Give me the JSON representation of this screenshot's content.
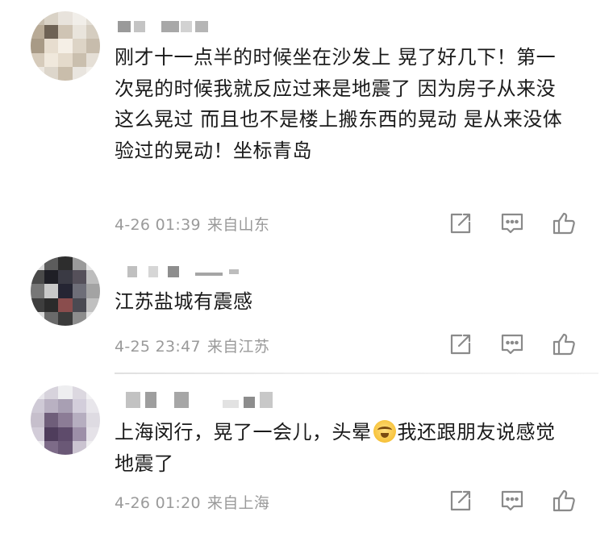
{
  "comments": [
    {
      "content": "刚才十一点半的时候坐在沙发上 晃了好几下！第一次晃的时候我就反应过来是地震了 因为房子从来没这么晃过 而且也不是楼上搬东西的晃动 是从来没体验过的晃动！坐标青岛",
      "time": "4-26 01:39",
      "location": "来自山东"
    },
    {
      "content": "江苏盐城有震感",
      "time": "4-25 23:47",
      "location": "来自江苏"
    },
    {
      "content_before_emoji": "上海闵行，晃了一会儿，头晕",
      "emoji": "crying-laughing-emoji",
      "content_after_emoji": "我还跟朋友说感觉地震了",
      "time": "4-26 01:20",
      "location": "来自上海"
    }
  ],
  "icons": [
    "share-icon",
    "reply-icon",
    "like-icon"
  ],
  "colors": {
    "text": "#1a1a1a",
    "meta": "#9a9a9a",
    "icon": "#8a8a8a"
  }
}
